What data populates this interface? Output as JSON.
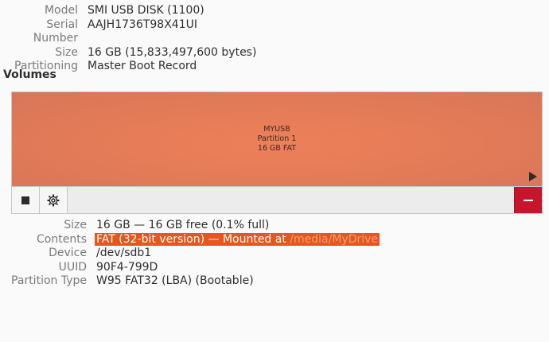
{
  "drive": {
    "model_label": "Model",
    "model": "SMI USB DISK (1100)",
    "serial_label": "Serial Number",
    "serial": "AAJH1736T98X41UI",
    "size_label": "Size",
    "size": "16 GB (15,833,497,600 bytes)",
    "partitioning_label": "Partitioning",
    "partitioning": "Master Boot Record"
  },
  "volumes": {
    "heading": "Volumes",
    "partition": {
      "name": "MYUSB",
      "number": "Partition 1",
      "summary": "16 GB FAT",
      "color": "#e8805c"
    }
  },
  "toolbar": {
    "stop_icon": "stop-icon",
    "gears_icon": "gears-icon",
    "delete_icon": "minus-icon",
    "delete_color": "#c7162b"
  },
  "partition_info": {
    "size_label": "Size",
    "size": "16 GB — 16 GB free (0.1% full)",
    "contents_label": "Contents",
    "contents_prefix": "FAT (32-bit version) — Mounted at ",
    "mount_point": "/media/MyDrive",
    "device_label": "Device",
    "device": "/dev/sdb1",
    "uuid_label": "UUID",
    "uuid": "90F4-799D",
    "type_label": "Partition Type",
    "type": "W95 FAT32 (LBA) (Bootable)"
  }
}
